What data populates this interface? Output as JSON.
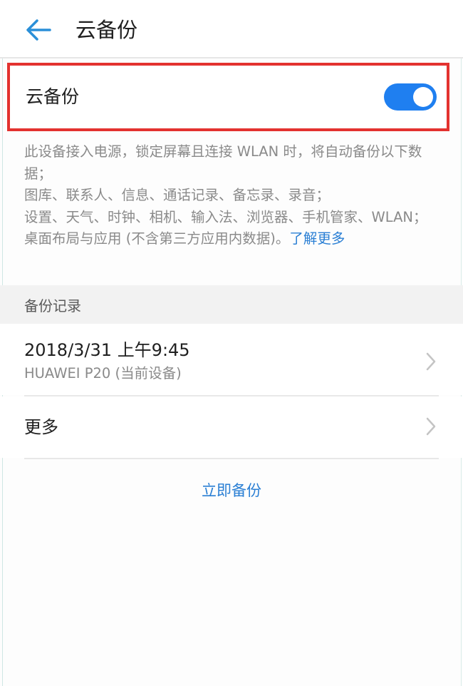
{
  "header": {
    "back_icon": "arrow-left-icon",
    "title": "云备份"
  },
  "backup_toggle": {
    "label": "云备份",
    "state": "on",
    "accent_color": "#1f7ff0",
    "highlight_color": "#e3322f"
  },
  "description": {
    "line1": "此设备接入电源，锁定屏幕且连接 WLAN 时，将自动备份以下数据；",
    "line2": "图库、联系人、信息、通话记录、备忘录、录音；",
    "line3": "设置、天气、时钟、相机、输入法、浏览器、手机管家、WLAN；",
    "line4": "桌面布局与应用 (不含第三方应用内数据)。",
    "learn_more": "了解更多"
  },
  "records_section": {
    "title": "备份记录",
    "items": [
      {
        "title": "2018/3/31 上午9:45",
        "subtitle": "HUAWEI P20 (当前设备)",
        "icon": "chevron-right-icon"
      },
      {
        "title": "更多",
        "icon": "chevron-right-icon"
      }
    ]
  },
  "actions": {
    "backup_now": "立即备份"
  },
  "colors": {
    "link": "#2a7fd4",
    "section_bg": "#f2f2f2"
  }
}
